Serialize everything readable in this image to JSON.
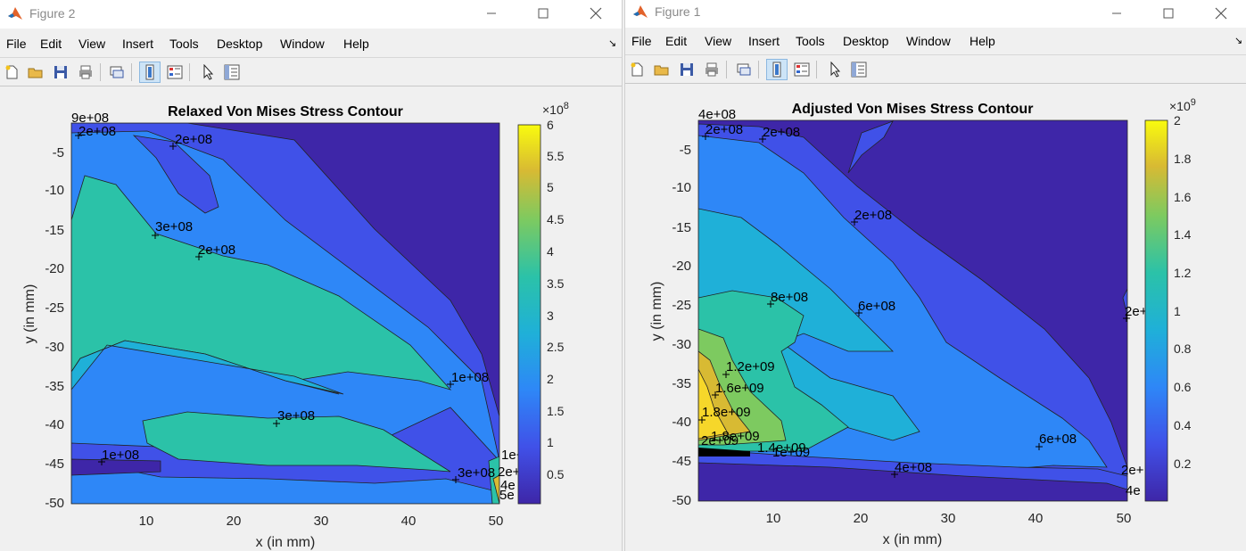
{
  "windows": {
    "left": {
      "title": "Figure 2",
      "menu": [
        "File",
        "Edit",
        "View",
        "Insert",
        "Tools",
        "Desktop",
        "Window",
        "Help"
      ],
      "plot_title": "Relaxed Von Mises Stress Contour",
      "xlabel": "x (in mm)",
      "ylabel": "y (in mm)",
      "x_ticks": [
        "10",
        "20",
        "30",
        "40",
        "50"
      ],
      "y_ticks": [
        "-5",
        "-10",
        "-15",
        "-20",
        "-25",
        "-30",
        "-35",
        "-40",
        "-45",
        "-50"
      ],
      "colorbar_exponent_base": "×10",
      "colorbar_exponent_power": "8",
      "colorbar_ticks": [
        "6",
        "5.5",
        "5",
        "4.5",
        "4",
        "3.5",
        "3",
        "2.5",
        "2",
        "1.5",
        "1",
        "0.5"
      ],
      "contour_labels": [
        "9e+08",
        "2e+08",
        "2e+08",
        "3e+08",
        "2e+08",
        "1e+08",
        "3e+08",
        "1e+08",
        "3e+08",
        "1e+08",
        "2e+",
        "4e",
        "5e"
      ]
    },
    "right": {
      "title": "Figure 1",
      "menu": [
        "File",
        "Edit",
        "View",
        "Insert",
        "Tools",
        "Desktop",
        "Window",
        "Help"
      ],
      "plot_title": "Adjusted Von Mises Stress Contour",
      "xlabel": "x (in mm)",
      "ylabel": "y (in mm)",
      "x_ticks": [
        "10",
        "20",
        "30",
        "40",
        "50"
      ],
      "y_ticks": [
        "-5",
        "-10",
        "-15",
        "-20",
        "-25",
        "-30",
        "-35",
        "-40",
        "-45",
        "-50"
      ],
      "colorbar_exponent_base": "×10",
      "colorbar_exponent_power": "9",
      "colorbar_ticks": [
        "2",
        "1.8",
        "1.6",
        "1.4",
        "1.2",
        "1",
        "0.8",
        "0.6",
        "0.4",
        "0.2"
      ],
      "contour_labels": [
        "4e+08",
        "2e+08",
        "2e+08",
        "2e+08",
        "8e+08",
        "6e+08",
        "2e+",
        "1.2e+09",
        "1.6e+09",
        "1.8e+09",
        "1.8e+09",
        "2e+09",
        "1.4e+09",
        "1e+09",
        "6e+08",
        "4e+08",
        "2e+",
        "4e"
      ]
    }
  },
  "colors": {
    "level1": "#3e26a8",
    "level2": "#4051e8",
    "level3": "#2e87f7",
    "level4": "#1fb0d8",
    "level5": "#2bc2a8",
    "level6": "#7dca60",
    "level7": "#d8ba33",
    "level8": "#f6d72a",
    "colorbar_top": "#f9fb0e"
  }
}
